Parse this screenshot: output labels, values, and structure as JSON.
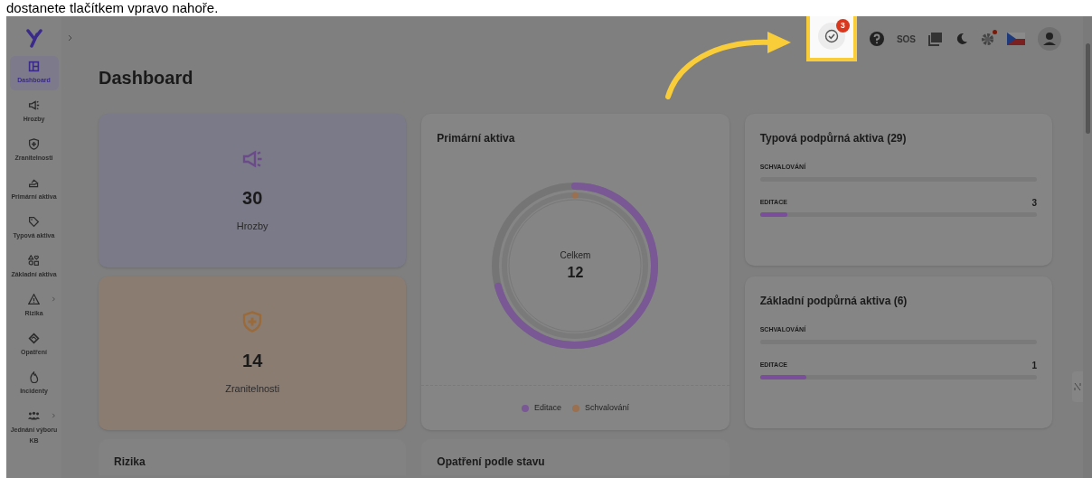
{
  "caption": "dostanete tlačítkem vpravo nahoře.",
  "header": {
    "tasks_badge": "3",
    "sos": "SOS",
    "settings_alert": true,
    "highlighted": true
  },
  "sidebar": {
    "items": [
      {
        "label": "Dashboard",
        "kind": "dashboard",
        "selected": true,
        "expandable": false
      },
      {
        "label": "Hrozby",
        "kind": "megaphone",
        "selected": false,
        "expandable": false
      },
      {
        "label": "Zranitelnosti",
        "kind": "shield",
        "selected": false,
        "expandable": false
      },
      {
        "label": "Primární aktiva",
        "kind": "hand",
        "selected": false,
        "expandable": false
      },
      {
        "label": "Typová aktiva",
        "kind": "tag",
        "selected": false,
        "expandable": false
      },
      {
        "label": "Základní aktiva",
        "kind": "shapes",
        "selected": false,
        "expandable": false
      },
      {
        "label": "Rizika",
        "kind": "warning",
        "selected": false,
        "expandable": true
      },
      {
        "label": "Opatření",
        "kind": "handshake",
        "selected": false,
        "expandable": false
      },
      {
        "label": "Incidenty",
        "kind": "fire",
        "selected": false,
        "expandable": false
      },
      {
        "label": "Jednání výboru KB",
        "kind": "people",
        "selected": false,
        "expandable": true
      }
    ]
  },
  "page_title": "Dashboard",
  "stat_cards": [
    {
      "kind": "megaphone",
      "count": "30",
      "label": "Hrozby",
      "color": "#7b7a89"
    },
    {
      "kind": "shield",
      "count": "14",
      "label": "Zranitelnosti",
      "color": "#8b7c72"
    }
  ],
  "primary_assets": {
    "title": "Primární aktiva",
    "center_label": "Celkem",
    "center_value": "12",
    "legend": [
      {
        "label": "Editace",
        "color": "#7a5896"
      },
      {
        "label": "Schvalování",
        "color": "#9a7050"
      }
    ]
  },
  "progress_cards": [
    {
      "title": "Typová podpůrná aktiva (29)",
      "rows": [
        {
          "label": "SCHVALOVÁNÍ",
          "level": 0
        },
        {
          "label": "EDITACE",
          "count": "3",
          "level": 0.1
        }
      ]
    },
    {
      "title": "Základní podpůrná aktiva (6)",
      "rows": [
        {
          "label": "SCHVALOVÁNÍ",
          "level": 0
        },
        {
          "label": "EDITACE",
          "count": "1",
          "level": 0.166
        }
      ]
    }
  ],
  "bottom_cards": [
    {
      "title": "Rizika"
    },
    {
      "title": "Opatření podle stavu"
    }
  ]
}
